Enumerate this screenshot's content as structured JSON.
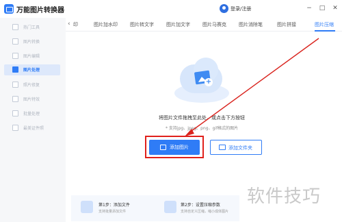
{
  "app": {
    "title": "万能图片转换器"
  },
  "user": {
    "login_label": "登录/注册"
  },
  "window": {
    "minimize": "−",
    "maximize": "□",
    "close": "✕"
  },
  "sidebar": {
    "items": [
      {
        "label": "热门工具",
        "icon": "hot-tools-icon"
      },
      {
        "label": "图片转换",
        "icon": "image-convert-icon"
      },
      {
        "label": "图片编辑",
        "icon": "image-edit-icon"
      },
      {
        "label": "图片处理",
        "icon": "image-process-icon",
        "active": true
      },
      {
        "label": "照片修复",
        "icon": "photo-repair-icon"
      },
      {
        "label": "图片特效",
        "icon": "image-effects-icon"
      },
      {
        "label": "批量处理",
        "icon": "batch-process-icon"
      },
      {
        "label": "最美证件照",
        "icon": "id-photo-icon"
      }
    ]
  },
  "tabs": {
    "prev_arrow": "‹",
    "items": [
      {
        "label": "印"
      },
      {
        "label": "图片加水印"
      },
      {
        "label": "图片转文字"
      },
      {
        "label": "图片加文字"
      },
      {
        "label": "图片马赛克"
      },
      {
        "label": "图片消除笔"
      },
      {
        "label": "图片拼接"
      },
      {
        "label": "图片压缩",
        "active": true
      }
    ]
  },
  "upload": {
    "drop_hint": "将图片文件拖拽至此处，或点击下方按钮",
    "format_hint": "* 支持jpg、jpeg、png、gif格式的图片",
    "add_image_label": "添加图片",
    "add_folder_label": "添加文件夹"
  },
  "steps": [
    {
      "title": "第1步：添加文件",
      "desc": "支持批量添加文件"
    },
    {
      "title": "第2步：设置压缩参数",
      "desc": "支持自定义压缩，缩小成体图片"
    }
  ],
  "watermark": {
    "text": "软件技巧"
  },
  "colors": {
    "accent": "#2f7cf6",
    "highlight": "#e0201b"
  }
}
